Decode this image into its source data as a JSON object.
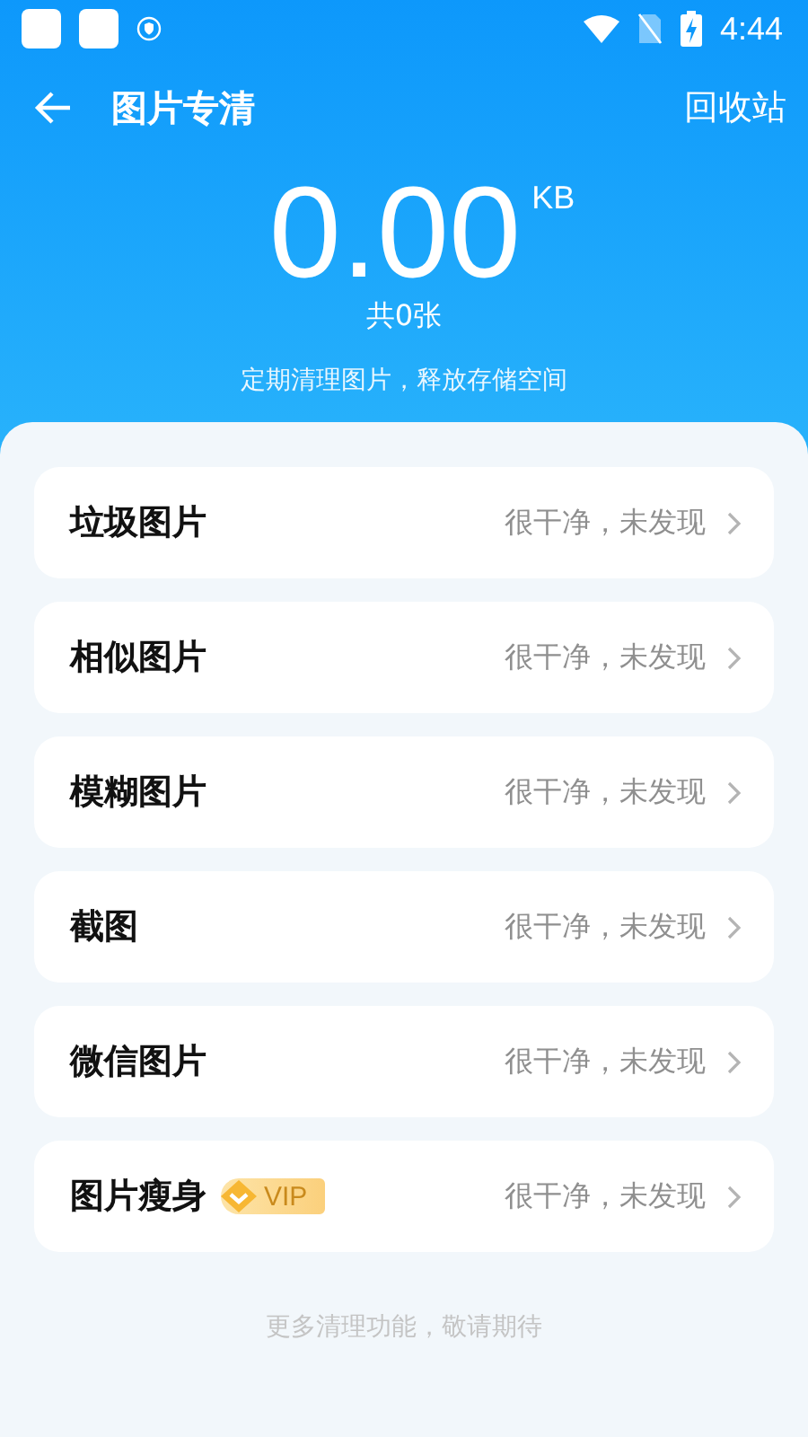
{
  "status_bar": {
    "time": "4:44"
  },
  "toolbar": {
    "title": "图片专清",
    "action": "回收站"
  },
  "summary": {
    "size": "0.00",
    "unit": "KB",
    "count": "共0张",
    "hint": "定期清理图片，释放存储空间"
  },
  "items": [
    {
      "label": "垃圾图片",
      "status": "很干净，未发现"
    },
    {
      "label": "相似图片",
      "status": "很干净，未发现"
    },
    {
      "label": "模糊图片",
      "status": "很干净，未发现"
    },
    {
      "label": "截图",
      "status": "很干净，未发现"
    },
    {
      "label": "微信图片",
      "status": "很干净，未发现"
    },
    {
      "label": "图片瘦身",
      "badge": "VIP",
      "status": "很干净，未发现"
    }
  ],
  "footer": "更多清理功能，敬请期待"
}
